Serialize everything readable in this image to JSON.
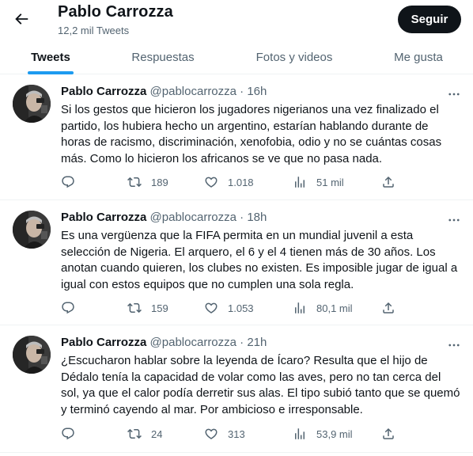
{
  "header": {
    "name": "Pablo Carrozza",
    "tweet_count": "12,2 mil Tweets",
    "follow_label": "Seguir"
  },
  "tabs": [
    {
      "label": "Tweets",
      "active": true
    },
    {
      "label": "Respuestas",
      "active": false
    },
    {
      "label": "Fotos y videos",
      "active": false
    },
    {
      "label": "Me gusta",
      "active": false
    }
  ],
  "tweets": [
    {
      "name": "Pablo Carrozza",
      "handle": "@pablocarrozza",
      "dot": "·",
      "time": "16h",
      "text": "Si los gestos que hicieron los jugadores nigerianos una vez finalizado el partido, los hubiera hecho un argentino, estarían hablando durante de horas de racismo, discriminación, xenofobia, odio y no se cuántas cosas más. Como lo hicieron los africanos se ve que no pasa nada.",
      "retweets": "189",
      "likes": "1.018",
      "views": "51 mil"
    },
    {
      "name": "Pablo Carrozza",
      "handle": "@pablocarrozza",
      "dot": "·",
      "time": "18h",
      "text": "Es una vergüenza que la FIFA permita en un mundial juvenil a esta selección de Nigeria. El arquero, el 6 y el 4 tienen más de 30 años. Los anotan cuando quieren, los clubes no existen. Es imposible jugar de igual a igual con estos equipos que no cumplen una sola regla.",
      "retweets": "159",
      "likes": "1.053",
      "views": "80,1 mil"
    },
    {
      "name": "Pablo Carrozza",
      "handle": "@pablocarrozza",
      "dot": "·",
      "time": "21h",
      "text": "¿Escucharon hablar sobre la leyenda de Ícaro? Resulta que el hijo de Dédalo tenía la capacidad de volar como las aves, pero no tan cerca del sol, ya que el calor podía derretir sus alas. El tipo subió tanto que se quemó y terminó cayendo al mar. Por ambicioso e irresponsable.",
      "retweets": "24",
      "likes": "313",
      "views": "53,9 mil"
    }
  ],
  "colors": {
    "accent": "#1d9bf0",
    "text": "#0f1419",
    "secondary": "#536471",
    "divider": "#eff3f4"
  },
  "icons": [
    "back-arrow-icon",
    "more-icon",
    "reply-icon",
    "retweet-icon",
    "like-icon",
    "views-icon",
    "share-icon"
  ]
}
